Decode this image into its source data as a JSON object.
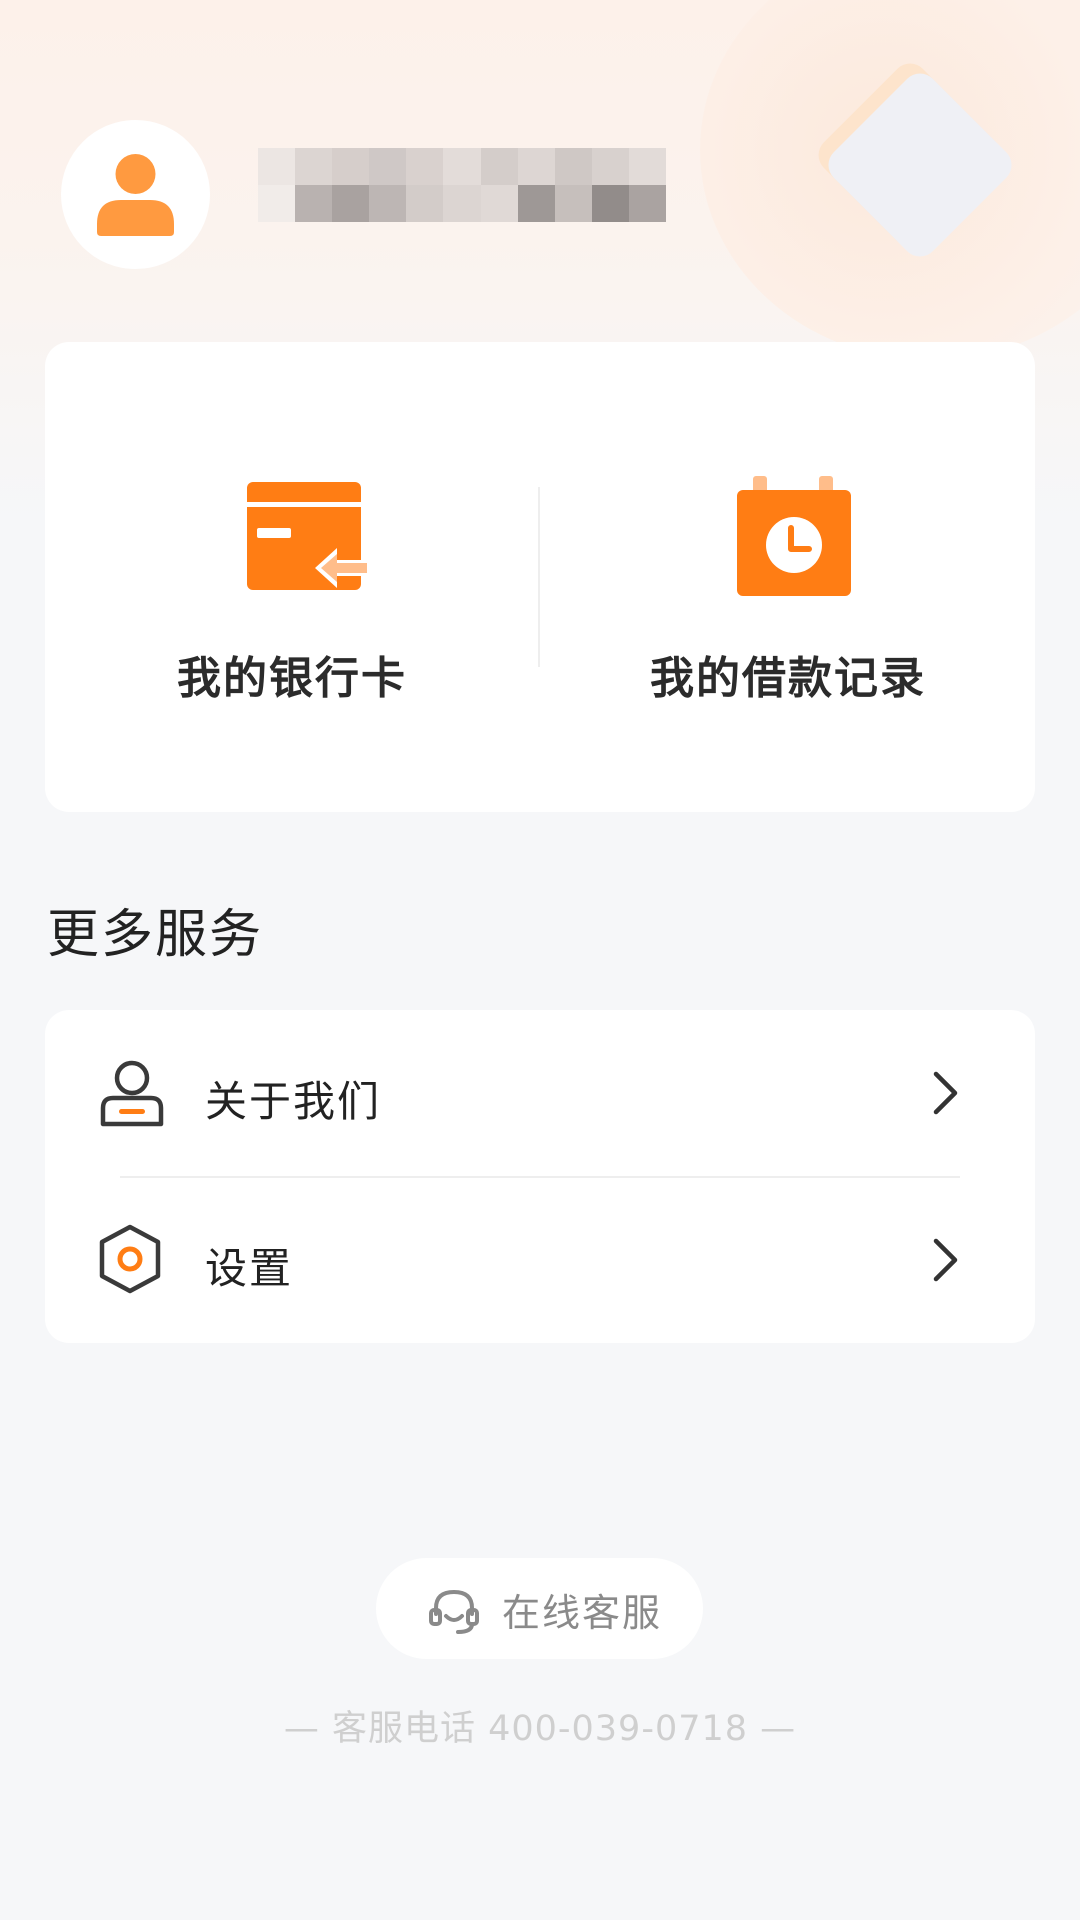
{
  "profile": {
    "avatar_icon": "user-icon",
    "username_masked": ""
  },
  "shortcuts": [
    {
      "label": "我的银行卡",
      "icon": "bank-card-icon"
    },
    {
      "label": "我的借款记录",
      "icon": "loan-record-clock-icon"
    }
  ],
  "more_services": {
    "title": "更多服务",
    "items": [
      {
        "label": "关于我们",
        "icon": "about-user-icon"
      },
      {
        "label": "设置",
        "icon": "settings-hexagon-icon"
      }
    ]
  },
  "customer_service": {
    "button_label": "在线客服",
    "icon": "headset-icon",
    "hotline": "— 客服电话 400-039-0718 —"
  },
  "colors": {
    "accent": "#ff7d14",
    "accent_light": "#ffa24c",
    "text_primary": "#222222",
    "text_muted": "#8a8a8a",
    "page_bg": "#f6f7f9"
  }
}
